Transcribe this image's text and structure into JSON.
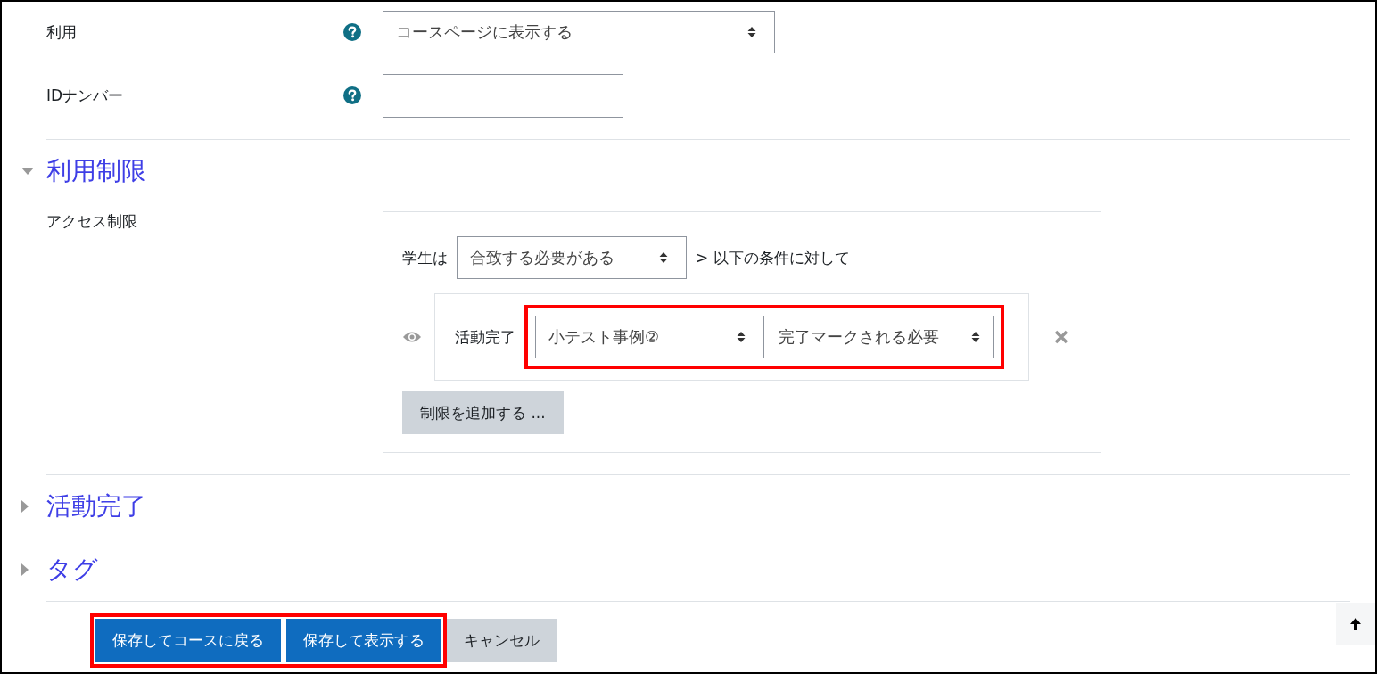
{
  "fields": [
    {
      "label": "利用",
      "kind": "select",
      "value": "コースページに表示する",
      "help": true
    },
    {
      "label": "IDナンバー",
      "kind": "text",
      "help": true
    }
  ],
  "sections": [
    {
      "title": "利用制限",
      "expanded": true,
      "access": {
        "label": "アクセス制限",
        "prefix": "学生は",
        "mode": "合致する必要がある",
        "suffix": "> 以下の条件に対して",
        "conditions": [
          {
            "type": "活動完了",
            "activity": "小テスト事例②",
            "requirement": "完了マークされる必要",
            "highlighted": true
          }
        ],
        "add_button": "制限を追加する ..."
      }
    },
    {
      "title": "活動完了",
      "expanded": false
    },
    {
      "title": "タグ",
      "expanded": false
    }
  ],
  "actions": {
    "highlighted": true,
    "buttons": [
      {
        "label": "保存してコースに戻る",
        "kind": "primary"
      },
      {
        "label": "保存して表示する",
        "kind": "primary"
      },
      {
        "label": "キャンセル",
        "kind": "secondary"
      }
    ]
  }
}
